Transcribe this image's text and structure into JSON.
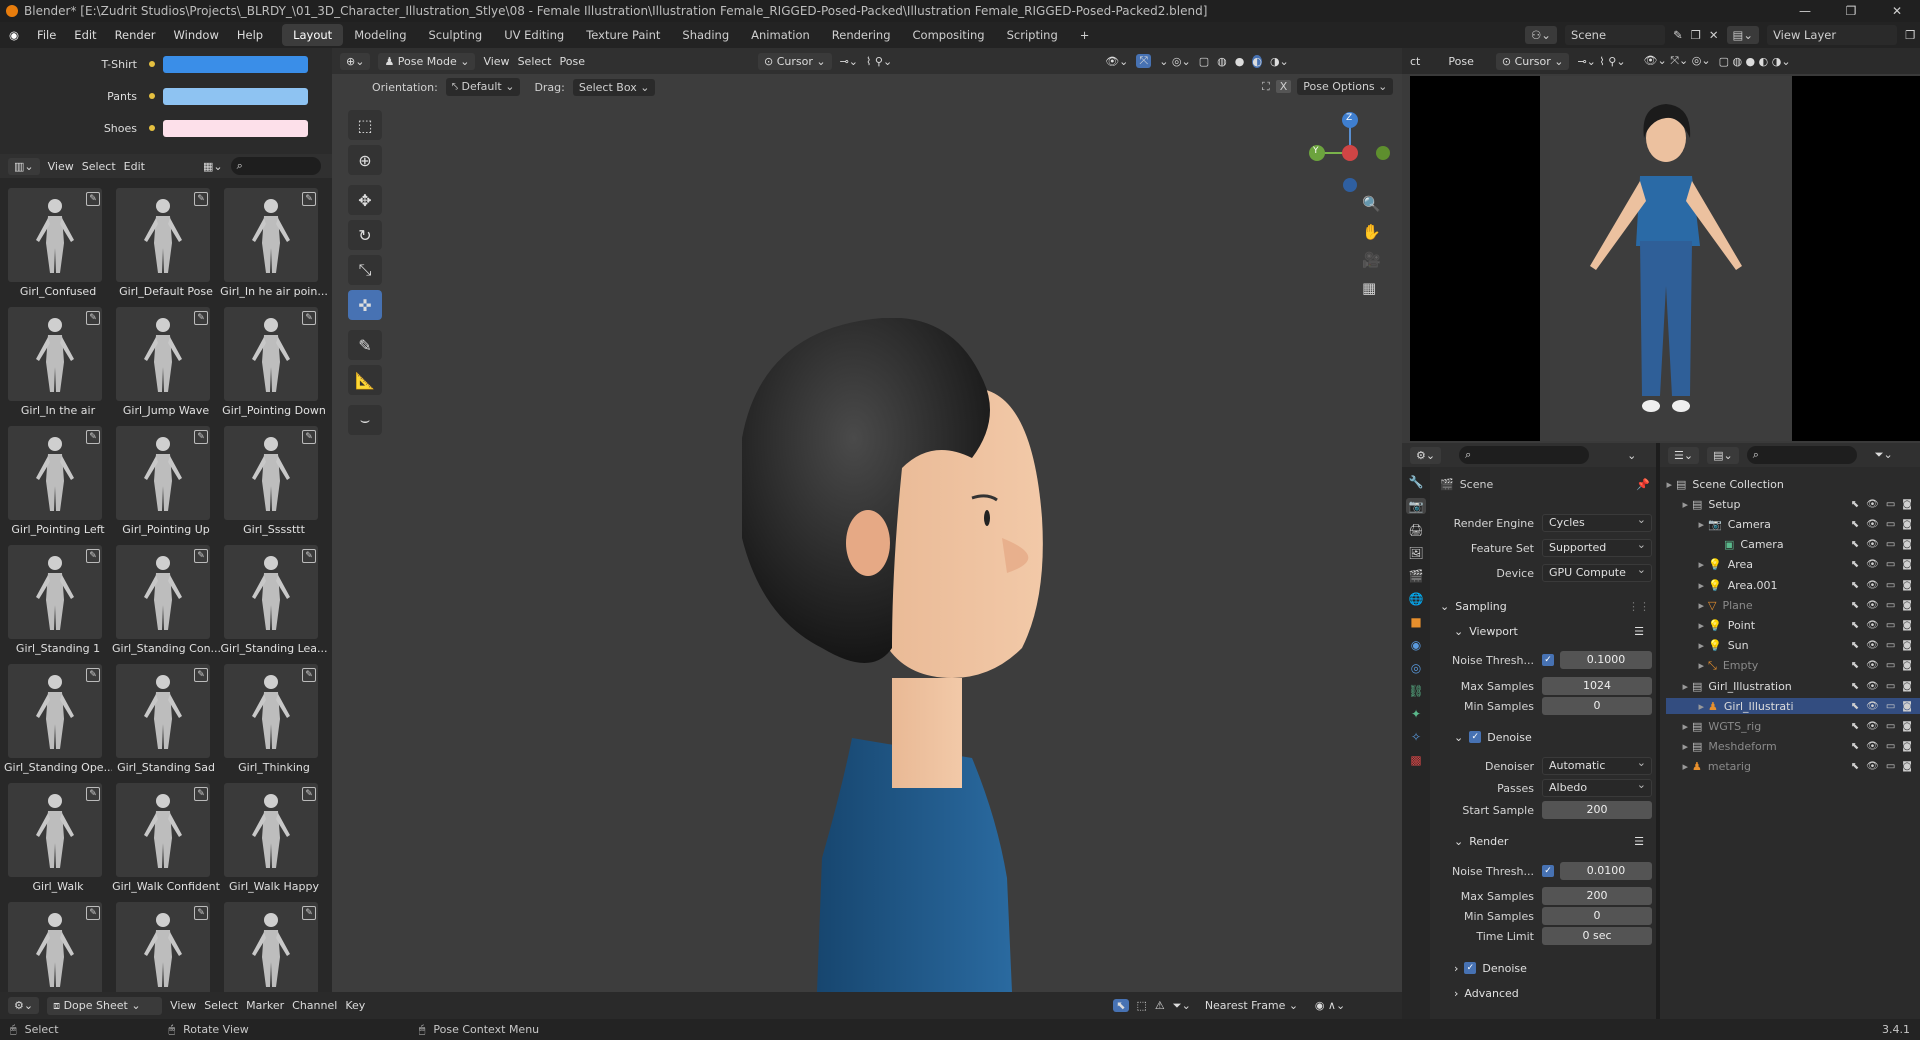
{
  "title": "Blender* [E:\\Zudrit Studios\\Projects\\_BLRDY_\\01_3D_Character_Illustration_Stlye\\08 - Female Illustration\\Illustration Female_RIGGED-Posed-Packed\\Illustration Female_RIGGED-Posed-Packed2.blend]",
  "menu": [
    "File",
    "Edit",
    "Render",
    "Window",
    "Help"
  ],
  "workspaces": [
    "Layout",
    "Modeling",
    "Sculpting",
    "UV Editing",
    "Texture Paint",
    "Shading",
    "Animation",
    "Rendering",
    "Compositing",
    "Scripting"
  ],
  "active_workspace": "Layout",
  "scene_name": "Scene",
  "view_layer": "View Layer",
  "colors_panel": [
    {
      "label": "T-Shirt",
      "color": "#3a8ee8"
    },
    {
      "label": "Pants",
      "color": "#8ec3f2"
    },
    {
      "label": "Shoes",
      "color": "#fde0ea"
    }
  ],
  "asset_header": {
    "view": "View",
    "select": "Select",
    "edit": "Edit"
  },
  "poses": [
    "Girl_Confused",
    "Girl_Default Pose",
    "Girl_In he air poin...",
    "Girl_In the air",
    "Girl_Jump Wave",
    "Girl_Pointing Down",
    "Girl_Pointing Left",
    "Girl_Pointing Up",
    "Girl_Ssssttt",
    "Girl_Standing 1",
    "Girl_Standing Con...",
    "Girl_Standing Lea...",
    "Girl_Standing Ope...",
    "Girl_Standing Sad",
    "Girl_Thinking",
    "Girl_Walk",
    "Girl_Walk Confident",
    "Girl_Walk Happy",
    "",
    "",
    ""
  ],
  "viewport_header": {
    "mode": "Pose Mode",
    "view": "View",
    "select": "Select",
    "pose": "Pose",
    "pivot": "Cursor"
  },
  "viewport_subheader": {
    "orientation_label": "Orientation:",
    "orientation": "Default",
    "drag_label": "Drag:",
    "drag": "Select Box",
    "pose_options": "Pose Options",
    "x_toggle": "X"
  },
  "gizmo": {
    "z": "Z",
    "y": "Y"
  },
  "camera_view_header": {
    "ct": "ct",
    "pose": "Pose",
    "pivot": "Cursor"
  },
  "properties": {
    "context": "Scene",
    "render_engine_label": "Render Engine",
    "render_engine": "Cycles",
    "feature_set_label": "Feature Set",
    "feature_set": "Supported",
    "device_label": "Device",
    "device": "GPU Compute",
    "sampling": "Sampling",
    "viewport": "Viewport",
    "vp_noise_label": "Noise Thresh...",
    "vp_noise": "0.1000",
    "vp_max_label": "Max Samples",
    "vp_max": "1024",
    "vp_min_label": "Min Samples",
    "vp_min": "0",
    "denoise": "Denoise",
    "denoiser_label": "Denoiser",
    "denoiser": "Automatic",
    "passes_label": "Passes",
    "passes": "Albedo",
    "start_label": "Start Sample",
    "start": "200",
    "render": "Render",
    "r_noise_label": "Noise Thresh...",
    "r_noise": "0.0100",
    "r_max_label": "Max Samples",
    "r_max": "200",
    "r_min_label": "Min Samples",
    "r_min": "0",
    "r_time_label": "Time Limit",
    "r_time": "0 sec",
    "r_denoise": "Denoise",
    "advanced": "Advanced"
  },
  "outliner": [
    {
      "label": "Scene Collection",
      "indent": 0,
      "icon": "collection",
      "dim": false
    },
    {
      "label": "Setup",
      "indent": 1,
      "icon": "collection",
      "dim": false
    },
    {
      "label": "Camera",
      "indent": 2,
      "icon": "camera",
      "dim": false
    },
    {
      "label": "Camera",
      "indent": 3,
      "icon": "camera-data",
      "dim": false
    },
    {
      "label": "Area",
      "indent": 2,
      "icon": "light",
      "dim": false
    },
    {
      "label": "Area.001",
      "indent": 2,
      "icon": "light",
      "dim": false
    },
    {
      "label": "Plane",
      "indent": 2,
      "icon": "mesh",
      "dim": true
    },
    {
      "label": "Point",
      "indent": 2,
      "icon": "light",
      "dim": false
    },
    {
      "label": "Sun",
      "indent": 2,
      "icon": "light",
      "dim": false
    },
    {
      "label": "Empty",
      "indent": 2,
      "icon": "empty",
      "dim": true
    },
    {
      "label": "Girl_Illustration",
      "indent": 1,
      "icon": "collection",
      "dim": false
    },
    {
      "label": "Girl_Illustrati",
      "indent": 2,
      "icon": "armature",
      "dim": false
    },
    {
      "label": "WGTS_rig",
      "indent": 1,
      "icon": "collection",
      "dim": true
    },
    {
      "label": "Meshdeform",
      "indent": 1,
      "icon": "collection",
      "dim": true
    },
    {
      "label": "metarig",
      "indent": 1,
      "icon": "armature",
      "dim": true
    }
  ],
  "timeline": {
    "editor": "Dope Sheet",
    "view": "View",
    "select": "Select",
    "marker": "Marker",
    "channel": "Channel",
    "key": "Key",
    "snap": "Nearest Frame"
  },
  "status": {
    "select": "Select",
    "rotate": "Rotate View",
    "context": "Pose Context Menu",
    "version": "3.4.1"
  }
}
